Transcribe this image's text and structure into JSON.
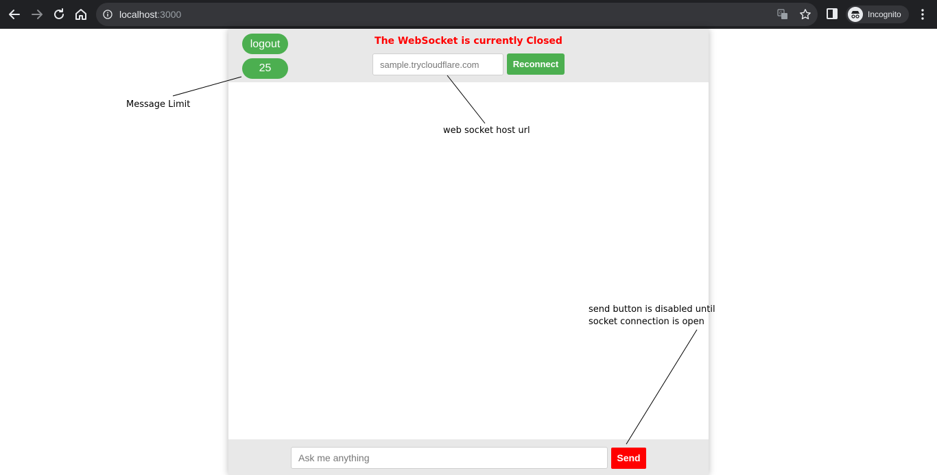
{
  "browser": {
    "url_host": "localhost",
    "url_port": ":3000",
    "profile_label": "Incognito",
    "icons": [
      "back-icon",
      "forward-icon",
      "reload-icon",
      "home-icon",
      "info-icon",
      "translate-icon",
      "star-icon",
      "side-panel-icon",
      "incognito-icon",
      "menu-icon"
    ]
  },
  "app": {
    "logout_label": "logout",
    "message_limit": "25",
    "status_text": "The WebSocket is currently Closed",
    "host_placeholder": "sample.trycloudflare.com",
    "reconnect_label": "Reconnect",
    "ask_placeholder": "Ask me anything",
    "send_label": "Send",
    "colors": {
      "accent_green": "#4caf50",
      "status_red": "#ff0000",
      "send_red": "#ff0000",
      "panel_gray": "#e8e8e8"
    }
  },
  "annotations": {
    "message_limit": "Message Limit",
    "host_url": "web socket host url",
    "send_line1": "send button is disabled until",
    "send_line2": "socket connection is open"
  }
}
